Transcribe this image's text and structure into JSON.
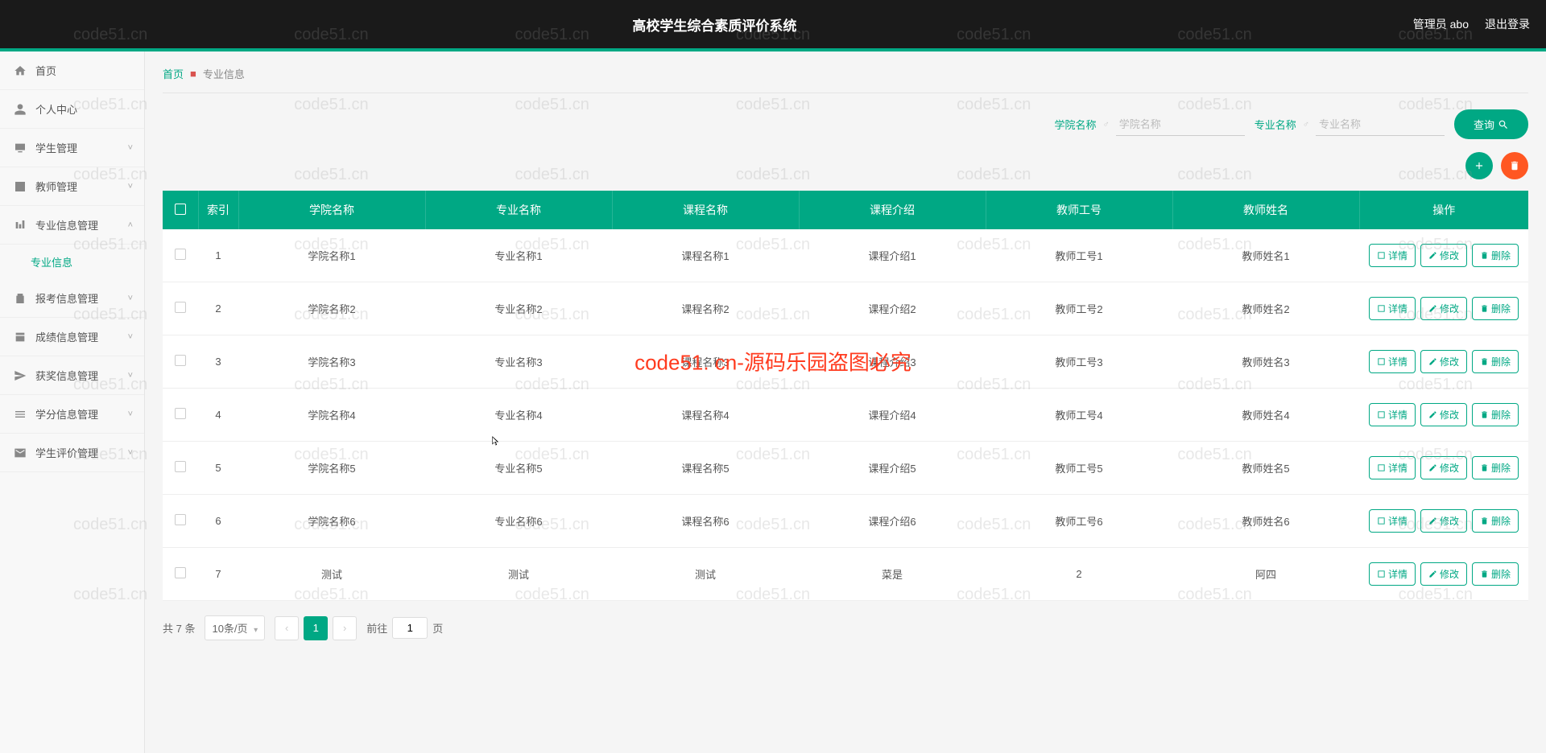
{
  "header": {
    "title": "高校学生综合素质评价系统",
    "user": "管理员 abo",
    "logout": "退出登录"
  },
  "sidebar": {
    "items": [
      {
        "label": "首页",
        "icon": "home",
        "expandable": false
      },
      {
        "label": "个人中心",
        "icon": "user",
        "expandable": false
      },
      {
        "label": "学生管理",
        "icon": "monitor",
        "expandable": true,
        "expanded": false
      },
      {
        "label": "教师管理",
        "icon": "edit-box",
        "expandable": true,
        "expanded": false
      },
      {
        "label": "专业信息管理",
        "icon": "bars",
        "expandable": true,
        "expanded": true,
        "sub": [
          {
            "label": "专业信息"
          }
        ]
      },
      {
        "label": "报考信息管理",
        "icon": "clipboard",
        "expandable": true,
        "expanded": false
      },
      {
        "label": "成绩信息管理",
        "icon": "score",
        "expandable": true,
        "expanded": false
      },
      {
        "label": "获奖信息管理",
        "icon": "send",
        "expandable": true,
        "expanded": false
      },
      {
        "label": "学分信息管理",
        "icon": "list",
        "expandable": true,
        "expanded": false
      },
      {
        "label": "学生评价管理",
        "icon": "mail",
        "expandable": true,
        "expanded": false
      }
    ]
  },
  "breadcrumb": {
    "home": "首页",
    "current": "专业信息"
  },
  "filters": {
    "f1_label": "学院名称",
    "f1_placeholder": "学院名称",
    "f2_label": "专业名称",
    "f2_placeholder": "专业名称",
    "search": "查询"
  },
  "table": {
    "headers": [
      "",
      "索引",
      "学院名称",
      "专业名称",
      "课程名称",
      "课程介绍",
      "教师工号",
      "教师姓名",
      "操作"
    ],
    "rows": [
      {
        "idx": "1",
        "c1": "学院名称1",
        "c2": "专业名称1",
        "c3": "课程名称1",
        "c4": "课程介绍1",
        "c5": "教师工号1",
        "c6": "教师姓名1"
      },
      {
        "idx": "2",
        "c1": "学院名称2",
        "c2": "专业名称2",
        "c3": "课程名称2",
        "c4": "课程介绍2",
        "c5": "教师工号2",
        "c6": "教师姓名2"
      },
      {
        "idx": "3",
        "c1": "学院名称3",
        "c2": "专业名称3",
        "c3": "课程名称3",
        "c4": "课程介绍3",
        "c5": "教师工号3",
        "c6": "教师姓名3"
      },
      {
        "idx": "4",
        "c1": "学院名称4",
        "c2": "专业名称4",
        "c3": "课程名称4",
        "c4": "课程介绍4",
        "c5": "教师工号4",
        "c6": "教师姓名4"
      },
      {
        "idx": "5",
        "c1": "学院名称5",
        "c2": "专业名称5",
        "c3": "课程名称5",
        "c4": "课程介绍5",
        "c5": "教师工号5",
        "c6": "教师姓名5"
      },
      {
        "idx": "6",
        "c1": "学院名称6",
        "c2": "专业名称6",
        "c3": "课程名称6",
        "c4": "课程介绍6",
        "c5": "教师工号6",
        "c6": "教师姓名6"
      },
      {
        "idx": "7",
        "c1": "测试",
        "c2": "测试",
        "c3": "测试",
        "c4": "菜是",
        "c5": "2",
        "c6": "阿四"
      }
    ],
    "ops": {
      "detail": "详情",
      "edit": "修改",
      "delete": "删除"
    }
  },
  "pagination": {
    "total": "共 7 条",
    "pagesize": "10条/页",
    "current": "1",
    "goto_prefix": "前往",
    "goto_value": "1",
    "goto_suffix": "页"
  },
  "watermark": {
    "text": "code51.cn",
    "center": "code51. cn-源码乐园盗图必究"
  }
}
